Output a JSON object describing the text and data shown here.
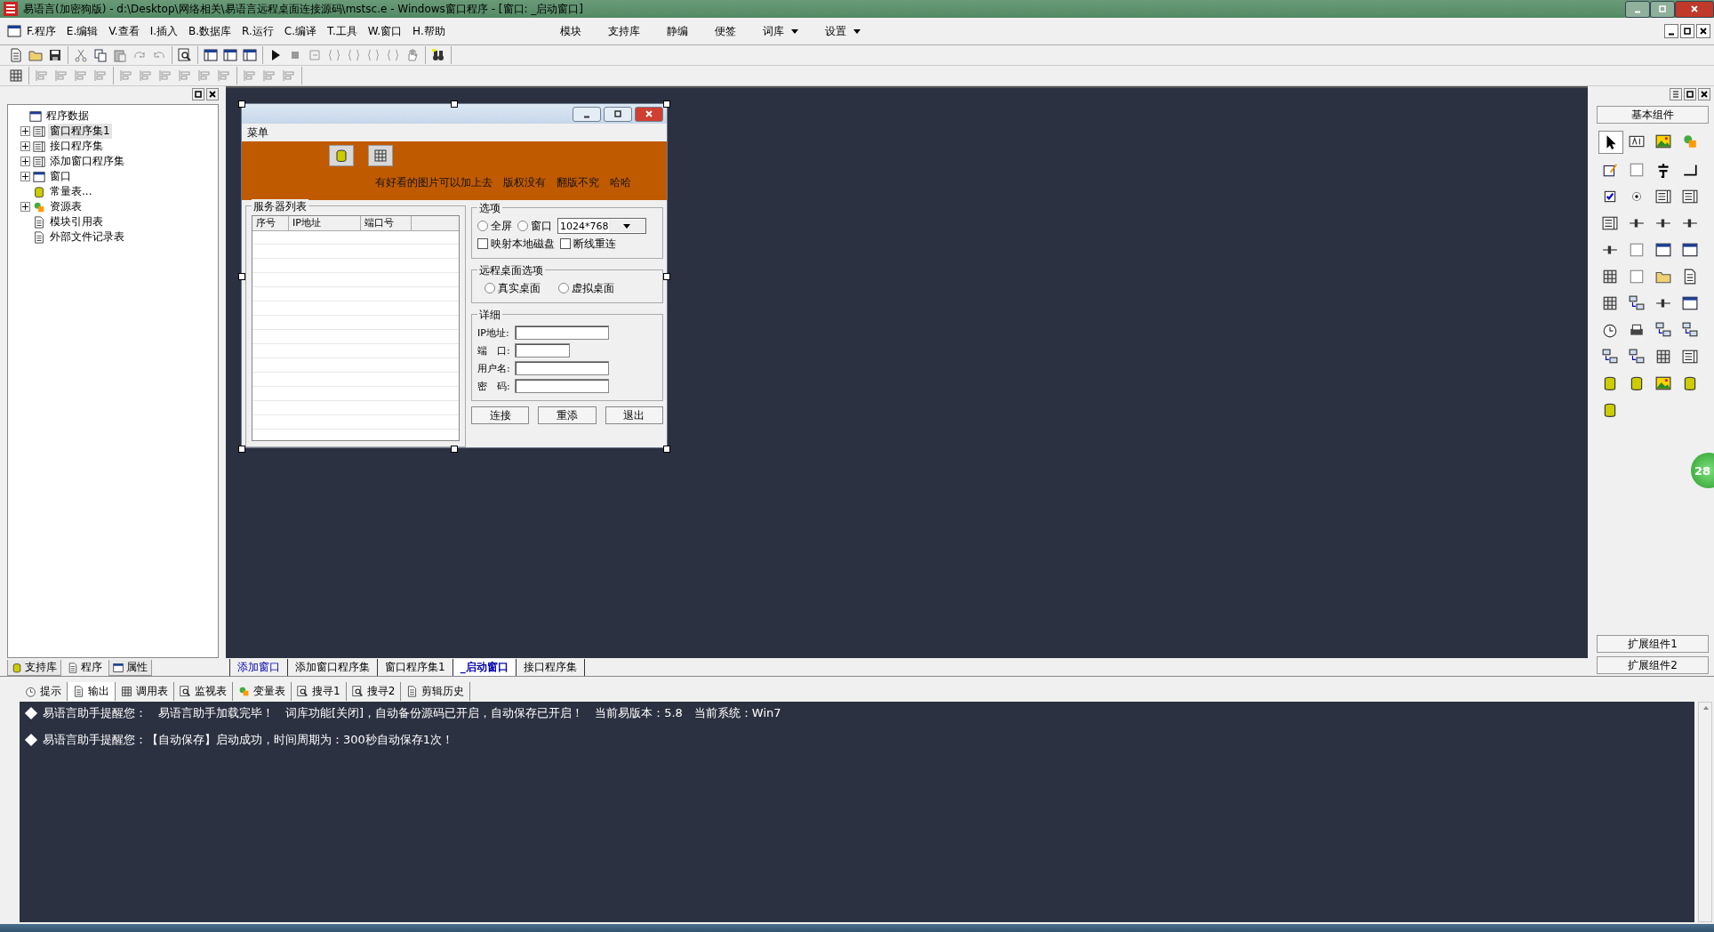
{
  "window": {
    "title": "易语言(加密狗版) - d:\\Desktop\\网络相关\\易语言远程桌面连接源码\\mstsc.e - Windows窗口程序 - [窗口: _启动窗口]"
  },
  "menu": [
    {
      "label": "F.程序"
    },
    {
      "label": "E.编辑"
    },
    {
      "label": "V.查看"
    },
    {
      "label": "I.插入"
    },
    {
      "label": "B.数据库"
    },
    {
      "label": "R.运行"
    },
    {
      "label": "C.编译"
    },
    {
      "label": "T.工具"
    },
    {
      "label": "W.窗口"
    },
    {
      "label": "H.帮助"
    }
  ],
  "quick_menu": [
    {
      "label": "模块",
      "dropdown": false
    },
    {
      "label": "支持库",
      "dropdown": false
    },
    {
      "label": "静编",
      "dropdown": false
    },
    {
      "label": "便签",
      "dropdown": false
    },
    {
      "label": "词库",
      "dropdown": true
    },
    {
      "label": "设置",
      "dropdown": true
    }
  ],
  "tree": [
    {
      "label": "程序数据",
      "kind": "root",
      "children": [
        {
          "label": "窗口程序集1",
          "kind": "group",
          "expanded": false,
          "selected": true
        },
        {
          "label": "接口程序集",
          "kind": "group",
          "expanded": false,
          "selected": false
        },
        {
          "label": "添加窗口程序集",
          "kind": "group",
          "expanded": false,
          "selected": false
        },
        {
          "label": "窗口",
          "kind": "window",
          "expanded": false,
          "selected": false
        },
        {
          "label": "常量表...",
          "kind": "constants",
          "selected": false
        },
        {
          "label": "资源表",
          "kind": "resources",
          "expanded": false,
          "selected": false
        },
        {
          "label": "模块引用表",
          "kind": "modules",
          "selected": false
        },
        {
          "label": "外部文件记录表",
          "kind": "files",
          "selected": false
        }
      ]
    }
  ],
  "left_tabs": [
    {
      "label": "支持库",
      "selected": false
    },
    {
      "label": "程序",
      "selected": true
    },
    {
      "label": "属性",
      "selected": false
    }
  ],
  "form": {
    "menu_label": "菜单",
    "banner_text": "有好看的图片可以加上去　版权没有　翻版不究　哈哈",
    "server_group": {
      "title": "服务器列表",
      "columns": [
        "序号",
        "IP地址",
        "端口号"
      ]
    },
    "options_group": {
      "title": "选项",
      "radios": [
        {
          "label": "全屏",
          "selected": false
        },
        {
          "label": "窗口",
          "selected": false
        }
      ],
      "resolution": "1024*768",
      "checkboxes": [
        {
          "label": "映射本地磁盘",
          "checked": false
        },
        {
          "label": "断线重连",
          "checked": false
        }
      ]
    },
    "desktop_group": {
      "title": "远程桌面选项",
      "radios": [
        {
          "label": "真实桌面",
          "selected": false
        },
        {
          "label": "虚拟桌面",
          "selected": false
        }
      ]
    },
    "detail_group": {
      "title": "详细",
      "fields": [
        {
          "label": "IP地址:",
          "short": false
        },
        {
          "label": "端　口:",
          "short": true
        },
        {
          "label": "用户名:",
          "short": false
        },
        {
          "label": "密　码:",
          "short": false
        }
      ]
    },
    "buttons": [
      "连接",
      "重添",
      "退出"
    ]
  },
  "doc_tabs": [
    {
      "label": "添加窗口",
      "selected": false,
      "modified": true
    },
    {
      "label": "添加窗口程序集",
      "selected": false,
      "modified": false
    },
    {
      "label": "窗口程序集1",
      "selected": false,
      "modified": false
    },
    {
      "label": "_启动窗口",
      "selected": true,
      "modified": false
    },
    {
      "label": "接口程序集",
      "selected": false,
      "modified": false
    }
  ],
  "palette": {
    "title": "基本组件",
    "bottom_buttons": [
      "扩展组件1",
      "扩展组件2"
    ]
  },
  "floating_badge": "28",
  "bottom_tabs": [
    {
      "label": "提示",
      "selected": false
    },
    {
      "label": "输出",
      "selected": true
    },
    {
      "label": "调用表",
      "selected": false
    },
    {
      "label": "监视表",
      "selected": false
    },
    {
      "label": "变量表",
      "selected": false
    },
    {
      "label": "搜寻1",
      "selected": false
    },
    {
      "label": "搜寻2",
      "selected": false
    },
    {
      "label": "剪辑历史",
      "selected": false
    }
  ],
  "output_lines": [
    "易语言助手提醒您：　易语言助手加载完毕！　词库功能[关闭]，自动备份源码已开启，自动保存已开启！　当前易版本：5.8　当前系统：Win7",
    "易语言助手提醒您：【自动保存】启动成功，时间周期为：300秒自动保存1次！"
  ]
}
